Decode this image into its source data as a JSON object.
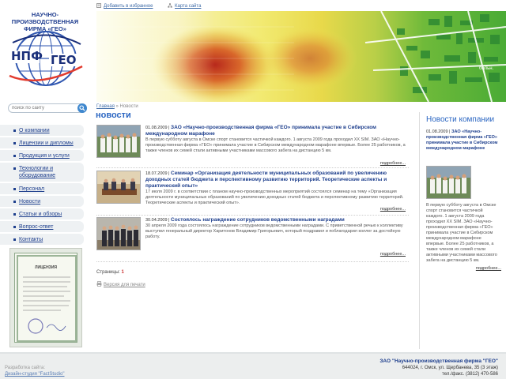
{
  "company": {
    "title_line1": "НАУЧНО-ПРОИЗВОДСТВЕННАЯ",
    "title_line2": "ФИРМА «ГЕО»",
    "logo_text_left": "НПФ",
    "logo_text_right": "ГЕО"
  },
  "topbar": {
    "favorites": "Добавить в избранное",
    "sitemap": "Карта сайта"
  },
  "search": {
    "placeholder": "поиск по сайту"
  },
  "menu": {
    "items": [
      {
        "label": "О компании"
      },
      {
        "label": "Лицензии и дипломы"
      },
      {
        "label": "Продукция и услуги"
      },
      {
        "label": "Технологии и оборудование"
      },
      {
        "label": "Персонал"
      },
      {
        "label": "Новости"
      },
      {
        "label": "Статьи и обзоры"
      },
      {
        "label": "Вопрос-ответ"
      },
      {
        "label": "Контакты"
      }
    ]
  },
  "license": {
    "doc_title": "ЛИЦЕНЗИЯ"
  },
  "banner": {
    "label": "больн."
  },
  "breadcrumb": {
    "home": "Главная",
    "sep": "»",
    "current": "Новости"
  },
  "page_title": "новости",
  "news": [
    {
      "date": "01.08.2009",
      "sep": " | ",
      "title": "ЗАО «Научно-производственная фирма «ГЕО» принимала участие в Сибирском международном марафоне",
      "text": "В первую субботу августа в Омске спорт становится частичкой каждого. 1 августа 2009 года проходил XX SIM. ЗАО «Научно-производственная фирма «ГЕО» принимала участие в Сибирском международном марафоне впервые. Более 25 работников, а также членов их семей стали активными участниками массового забега на дистанцию 5 км.",
      "more": "подробнее..."
    },
    {
      "date": "18.07.2009",
      "sep": " | ",
      "title": "Семинар «Организация деятельности муниципальных образований по увеличению доходных статей бюджета и перспективному развитию территорий. Теоретические аспекты и практический опыт»",
      "text": "17 июля 2009 г. в соответствии с планом научно-производственных мероприятий состоялся семинар на тему «Организация деятельности муниципальных образований по увеличению доходных статей бюджета и перспективному развитию территорий. Теоретические аспекты и практический опыт».",
      "more": "подробнее..."
    },
    {
      "date": "30.04.2009",
      "sep": " | ",
      "title": "Состоялось награждение сотрудников ведомственными наградами",
      "text": "30 апреля 2009 года состоялось награждение сотрудников ведомственными наградами. С приветственной речью к коллективу выступил генеральный директор Харитонов Владимир Григорьевич, который поздравил и поблагодарил коллег за достойную работу.",
      "more": "подробнее..."
    }
  ],
  "pagination": {
    "label": "Страницы:",
    "current": "1"
  },
  "print_version": "Версия для печати",
  "sidebar_news": {
    "title": "Новости компании",
    "date": "01.08.2009",
    "sep": " | ",
    "headline": "ЗАО «Научно-производственная фирма «ГЕО» принимала участие в Сибирском международном марафоне",
    "text": "В первую субботу августа в Омске спорт становится частичкой каждого. 1 августа 2009 года проходил XX SIM. ЗАО «Научно-производственная фирма «ГЕО» принимала участие в Сибирском международном марафоне впервые. Более 25 работников, а также членов их семей стали активными участниками массового забега на дистанцию 5 км.",
    "more": "подробнее..."
  },
  "footer": {
    "dev_label": "Разработка сайта:",
    "dev_link": "Дизайн-студия \"FactStudio\"",
    "company": "ЗАО \"Научно-производственная фирма \"ГЕО\"",
    "address": "644024, г. Омск, ул. Щербанева, 35 (3 этаж)",
    "phone": "тел./факс. (3812) 470-586"
  },
  "colors": {
    "link": "#1e3f8d",
    "accent": "#2b66c2",
    "highlight": "#cc3333"
  }
}
